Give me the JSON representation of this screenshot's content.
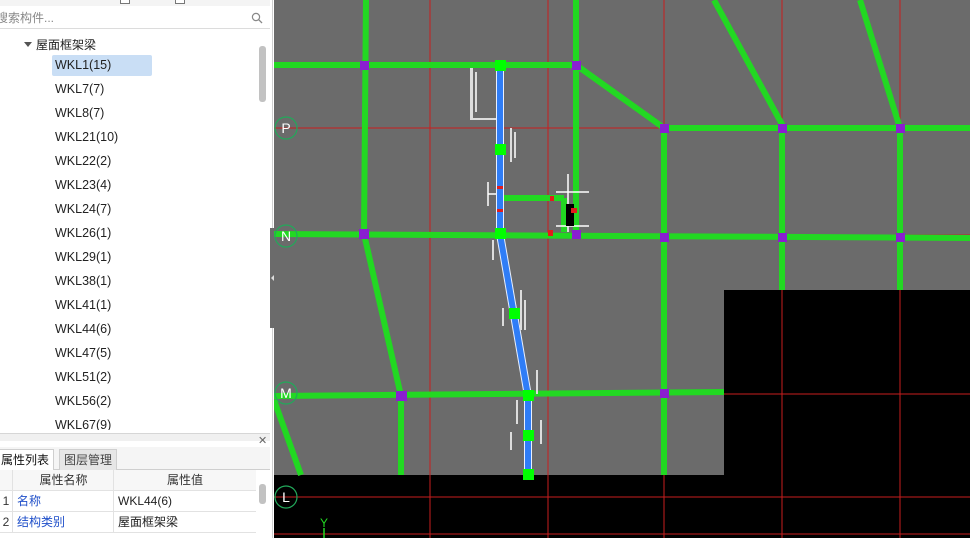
{
  "search": {
    "placeholder": "搜索构件..."
  },
  "tree": {
    "group_label": "屋面框架梁",
    "items": [
      {
        "label": "WKL1(15)"
      },
      {
        "label": "WKL7(7)"
      },
      {
        "label": "WKL8(7)"
      },
      {
        "label": "WKL21(10)"
      },
      {
        "label": "WKL22(2)"
      },
      {
        "label": "WKL23(4)"
      },
      {
        "label": "WKL24(7)"
      },
      {
        "label": "WKL26(1)"
      },
      {
        "label": "WKL29(1)"
      },
      {
        "label": "WKL38(1)"
      },
      {
        "label": "WKL41(1)"
      },
      {
        "label": "WKL44(6)"
      },
      {
        "label": "WKL47(5)"
      },
      {
        "label": "WKL51(2)"
      },
      {
        "label": "WKL56(2)"
      },
      {
        "label": "WKL67(9)"
      }
    ],
    "selected_index": 0
  },
  "tabs": {
    "properties": "属性列表",
    "layers": "图层管理"
  },
  "properties": {
    "header_name": "属性名称",
    "header_value": "属性值",
    "rows": [
      {
        "index": "1",
        "name": "名称",
        "value": "WKL44(6)"
      },
      {
        "index": "2",
        "name": "结构类别",
        "value": "屋面框架梁"
      }
    ]
  },
  "canvas": {
    "axes": {
      "p": "P",
      "n": "N",
      "m": "M",
      "l": "L",
      "y": "Y"
    },
    "colors": {
      "background": "#000000",
      "slab": "#6b6b6b",
      "beam": "#22d822",
      "selected_beam": "#2f7df6",
      "grid_line": "#c81e1e",
      "column": "#8a1fd0",
      "node": "#00ff00"
    }
  }
}
